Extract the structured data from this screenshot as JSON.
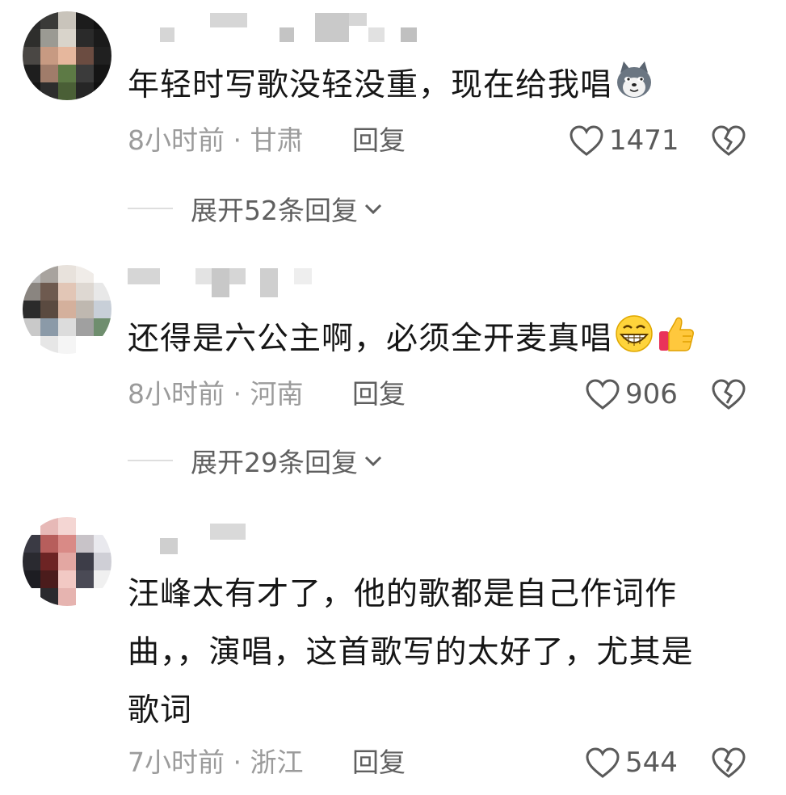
{
  "comments": [
    {
      "text": "年轻时写歌没轻没重，现在给我唱",
      "emojis": [
        "wolf-emoji"
      ],
      "time_location": "8小时前 · 甘肃",
      "reply_label": "回复",
      "likes": "1471",
      "expand_label": "展开52条回复"
    },
    {
      "text": "还得是六公主啊，必须全开麦真唱",
      "emojis": [
        "grin-emoji",
        "thumbs-up-emoji"
      ],
      "time_location": "8小时前 · 河南",
      "reply_label": "回复",
      "likes": "906",
      "expand_label": "展开29条回复"
    },
    {
      "text_lines": [
        "汪峰太有才了，他的歌都是自己作词作",
        "曲，，演唱，这首歌写的太好了，尤其是",
        "歌词"
      ],
      "time_location": "7小时前 · 浙江",
      "reply_label": "回复",
      "likes": "544"
    }
  ],
  "colors": {
    "text": "#161616",
    "meta": "#9b9b9b",
    "action": "#5f5f5f",
    "background": "#ffffff"
  },
  "icons": [
    "heart-outline-icon",
    "broken-heart-icon",
    "chevron-down-icon"
  ]
}
